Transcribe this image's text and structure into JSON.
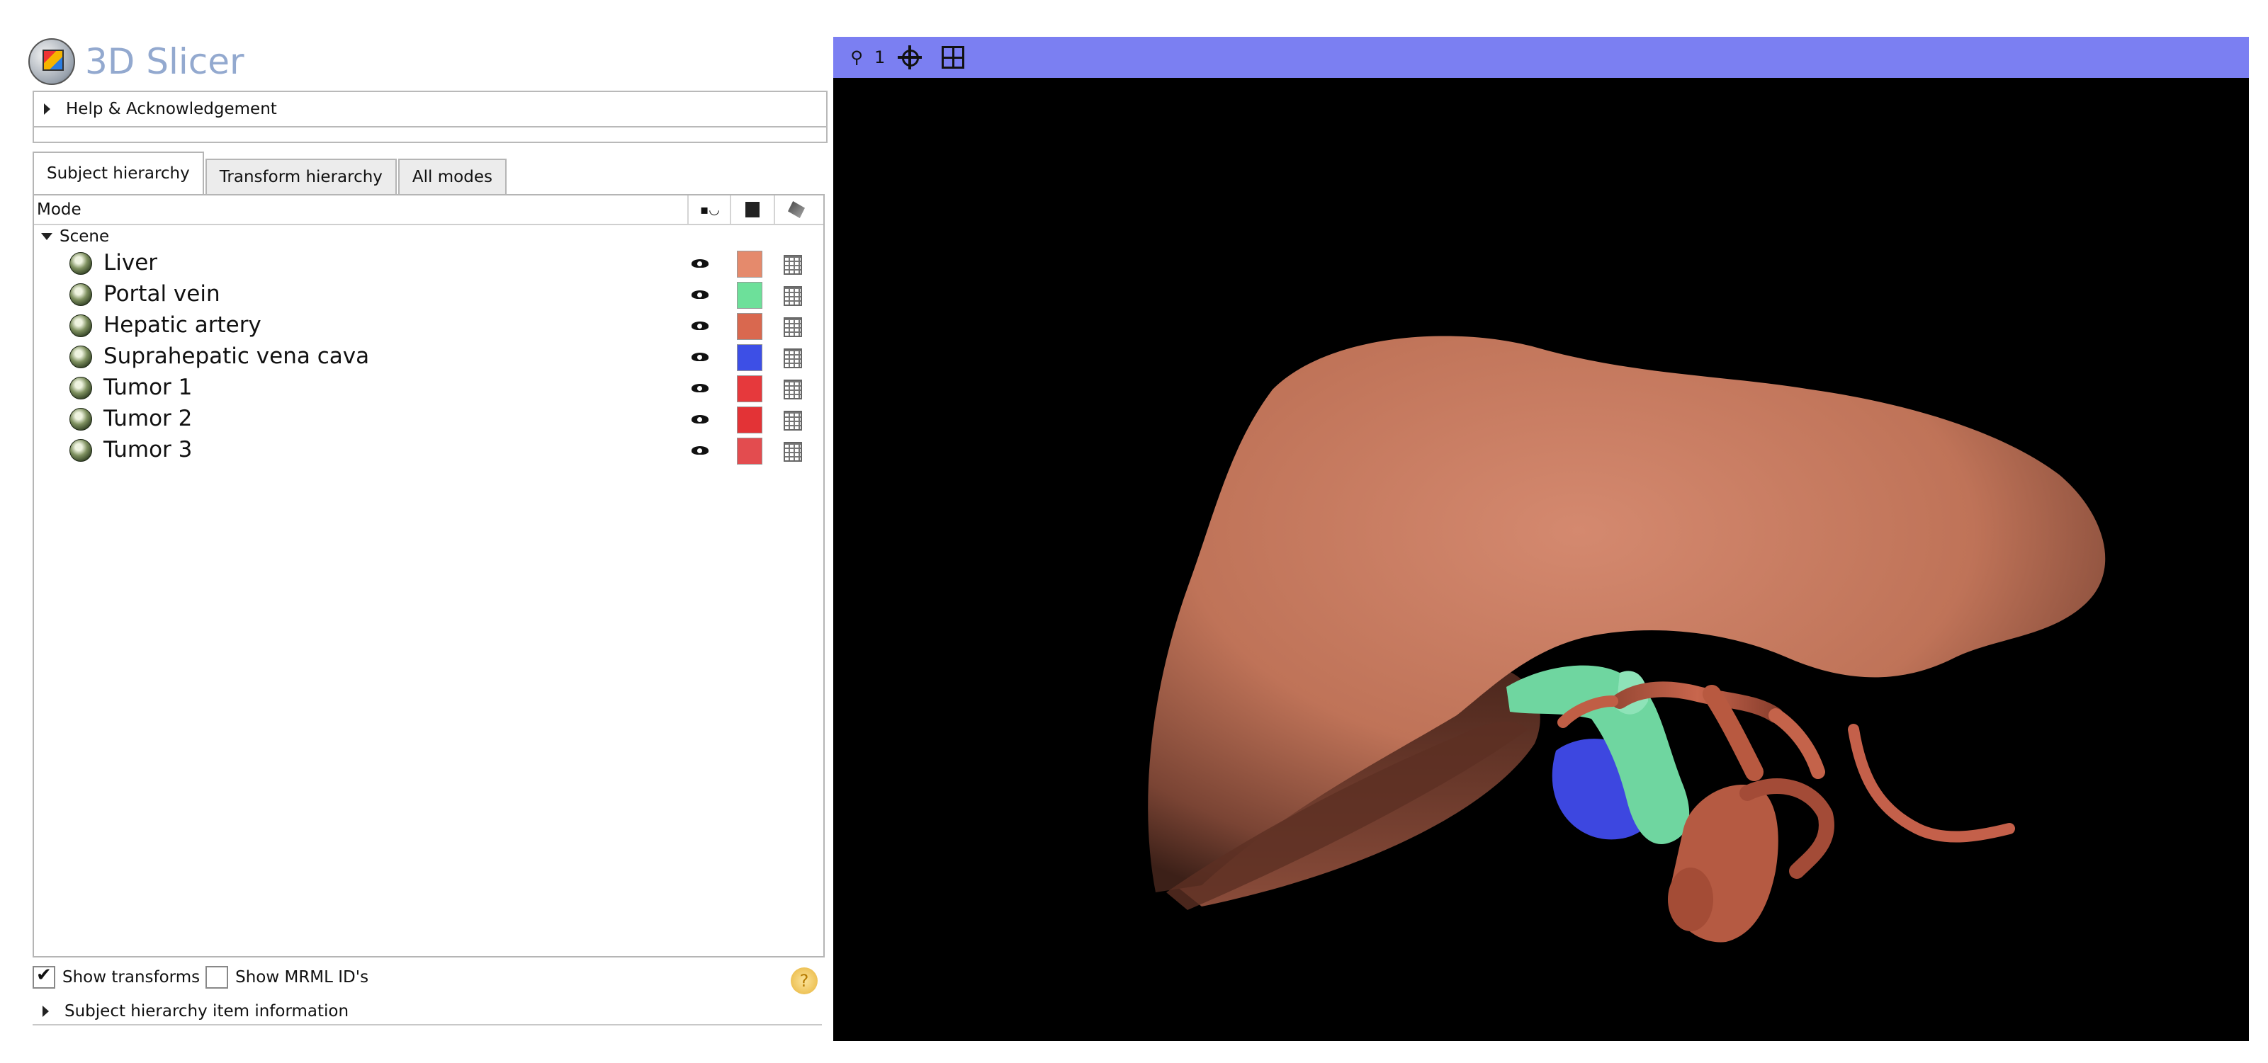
{
  "app": {
    "title": "3D Slicer"
  },
  "help_section": {
    "label": "Help & Acknowledgement"
  },
  "tabs": [
    {
      "label": "Subject hierarchy",
      "active": true
    },
    {
      "label": "Transform hierarchy",
      "active": false
    },
    {
      "label": "All modes",
      "active": false
    }
  ],
  "tree": {
    "header": {
      "mode": "Mode",
      "visibility_icon": "visibility-toggle-icon",
      "color_icon": "color-square-icon",
      "paint_icon": "paint-icon"
    },
    "scene_label": "Scene",
    "items": [
      {
        "name": "Liver",
        "color": "#e58a6c",
        "visible": true
      },
      {
        "name": "Portal vein",
        "color": "#6de09a",
        "visible": true
      },
      {
        "name": "Hepatic artery",
        "color": "#d9684f",
        "visible": true
      },
      {
        "name": "Suprahepatic vena cava",
        "color": "#3d4fe6",
        "visible": true
      },
      {
        "name": "Tumor 1",
        "color": "#e6393c",
        "visible": true
      },
      {
        "name": "Tumor 2",
        "color": "#e33336",
        "visible": true
      },
      {
        "name": "Tumor 3",
        "color": "#e34c4f",
        "visible": true
      }
    ]
  },
  "footer": {
    "show_transforms": {
      "label": "Show transforms",
      "checked": true
    },
    "show_mrml_ids": {
      "label": "Show MRML ID's",
      "checked": false
    },
    "info_section": "Subject hierarchy item information"
  },
  "view3d": {
    "toolbar_color": "#7b7ff2",
    "view_number": "1",
    "background": "#000000",
    "icons": [
      "pin-icon",
      "center-view-icon",
      "layout-icon"
    ]
  }
}
